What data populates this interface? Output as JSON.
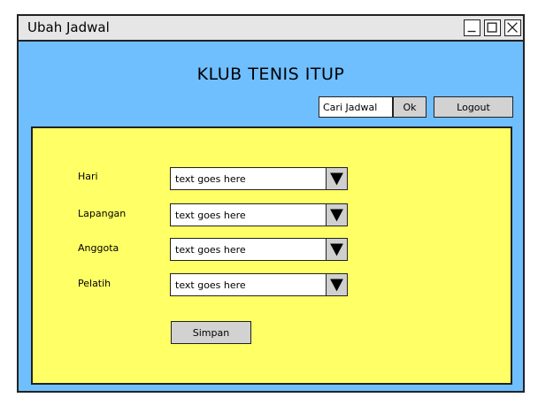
{
  "window": {
    "title": "Ubah Jadwal"
  },
  "header": {
    "heading": "KLUB TENIS ITUP",
    "search_value": "Cari Jadwal",
    "ok_label": "Ok",
    "logout_label": "Logout"
  },
  "form": {
    "fields": [
      {
        "label": "Hari",
        "value": "text goes here"
      },
      {
        "label": "Lapangan",
        "value": "text goes here"
      },
      {
        "label": "Anggota",
        "value": "text goes here"
      },
      {
        "label": "Pelatih",
        "value": "text goes here"
      }
    ],
    "save_label": "Simpan"
  },
  "icons": {
    "minimize": "minimize-icon",
    "maximize": "maximize-icon",
    "close": "close-icon",
    "dropdown": "triangle-down-icon"
  },
  "colors": {
    "window_bg": "#6fbfff",
    "panel_bg": "#ffff66",
    "titlebar_bg": "#e6e6e6",
    "button_bg": "#d2d2d2"
  }
}
